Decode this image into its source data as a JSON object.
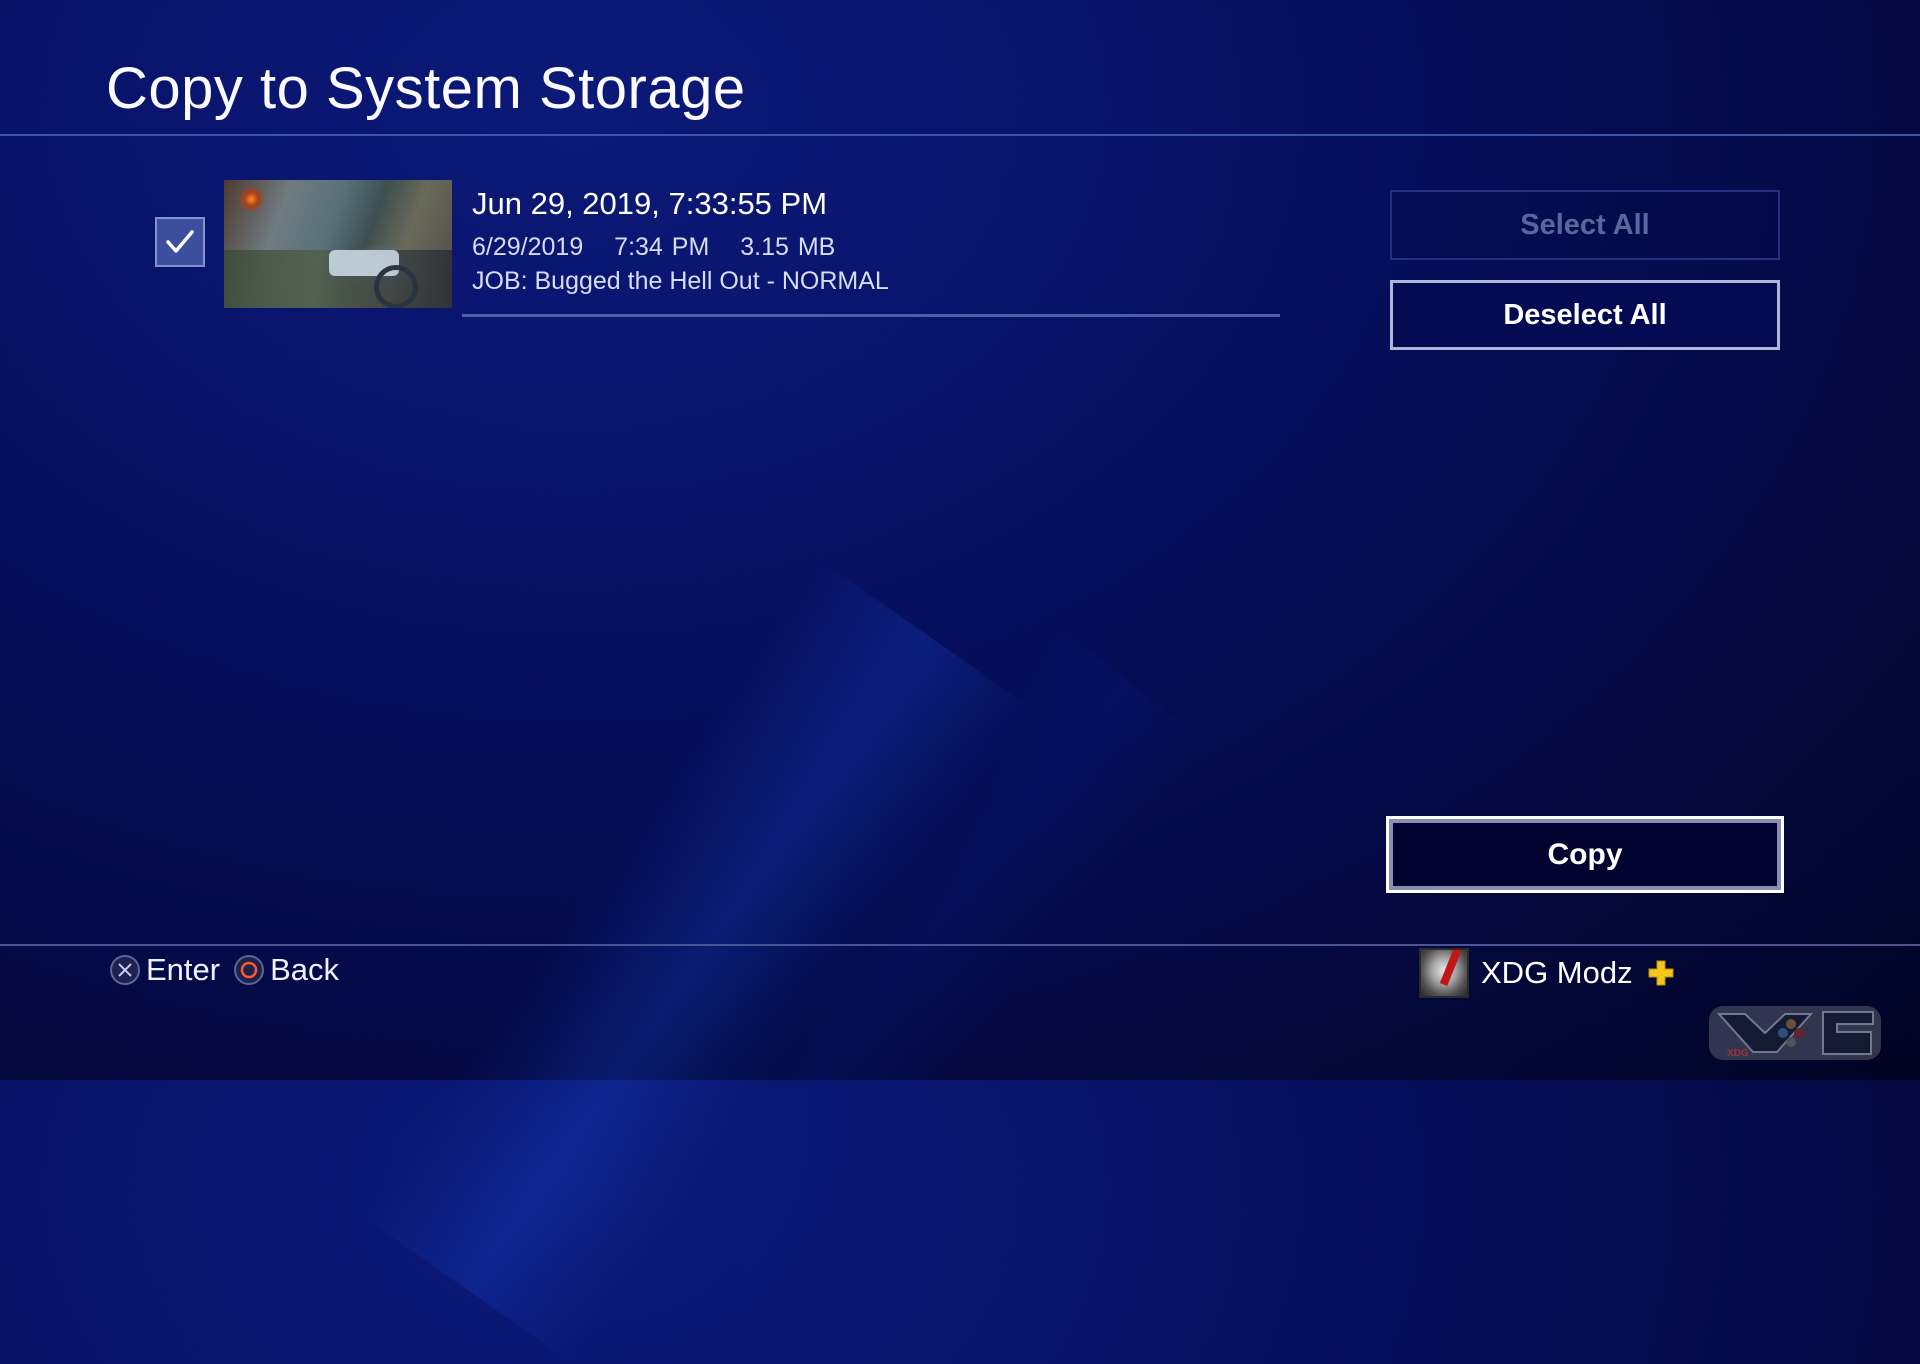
{
  "page": {
    "title": "Copy to System Storage"
  },
  "items": [
    {
      "checked": true,
      "title": "Jun 29, 2019, 7:33:55 PM",
      "date": "6/29/2019",
      "time": "7:34 PM",
      "size": "3.15 MB",
      "description": "JOB: Bugged the Hell Out - NORMAL"
    }
  ],
  "actions": {
    "select_all": "Select All",
    "deselect_all": "Deselect All",
    "copy": "Copy"
  },
  "footer": {
    "hints": [
      {
        "icon": "cross-button-icon",
        "label": "Enter"
      },
      {
        "icon": "circle-button-icon",
        "label": "Back"
      }
    ],
    "user": {
      "name": "XDG Modz",
      "plus_badge": "playstation-plus-icon"
    }
  },
  "colors": {
    "background": "#081268",
    "accent_plus": "#f5c518",
    "circle_button": "#ff5a2a"
  },
  "watermark": {
    "text": "XDG"
  }
}
